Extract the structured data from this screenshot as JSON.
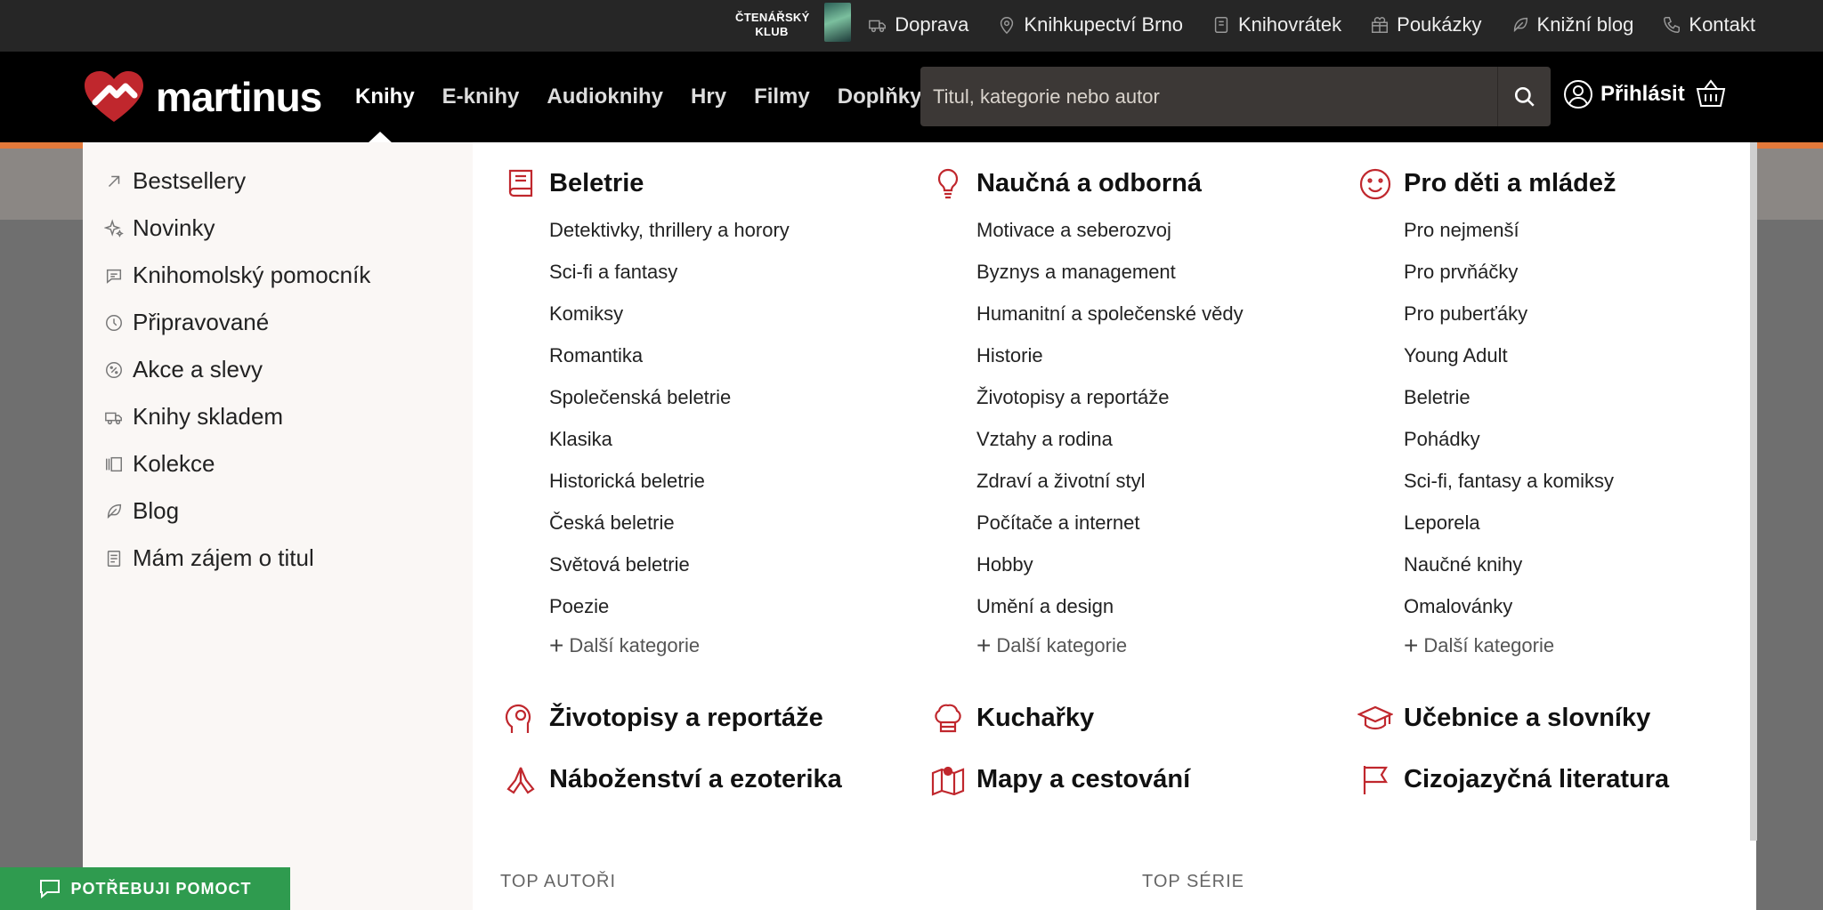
{
  "topbar": {
    "club_line1": "ČTENÁŘSKÝ",
    "club_line2": "KLUB",
    "links": [
      {
        "label": "Doprava",
        "icon": "truck-icon"
      },
      {
        "label": "Knihkupectví Brno",
        "icon": "map-pin-icon"
      },
      {
        "label": "Knihovrátek",
        "icon": "book-return-icon"
      },
      {
        "label": "Poukázky",
        "icon": "gift-icon"
      },
      {
        "label": "Knižní blog",
        "icon": "feather-icon"
      },
      {
        "label": "Kontakt",
        "icon": "phone-icon"
      }
    ]
  },
  "header": {
    "logo_text": "martinus",
    "nav": [
      {
        "label": "Knihy",
        "active": true
      },
      {
        "label": "E-knihy"
      },
      {
        "label": "Audioknihy"
      },
      {
        "label": "Hry"
      },
      {
        "label": "Filmy"
      },
      {
        "label": "Doplňky"
      }
    ],
    "search_placeholder": "Titul, kategorie nebo autor",
    "login_label": "Přihlásit"
  },
  "sidebar": {
    "items": [
      {
        "label": "Bestsellery",
        "icon": "arrow-up-right-icon"
      },
      {
        "label": "Novinky",
        "icon": "sparkle-icon"
      },
      {
        "label": "Knihomolský pomocník",
        "icon": "chat-icon"
      },
      {
        "label": "Připravované",
        "icon": "clock-icon"
      },
      {
        "label": "Akce a slevy",
        "icon": "discount-icon"
      },
      {
        "label": "Knihy skladem",
        "icon": "truck-icon"
      },
      {
        "label": "Kolekce",
        "icon": "collection-icon"
      },
      {
        "label": "Blog",
        "icon": "feather-icon"
      },
      {
        "label": "Mám zájem o titul",
        "icon": "document-icon"
      }
    ]
  },
  "columns": [
    {
      "title": "Beletrie",
      "icon": "book-icon",
      "items": [
        "Detektivky, thrillery a horory",
        "Sci-fi a fantasy",
        "Komiksy",
        "Romantika",
        "Společenská beletrie",
        "Klasika",
        "Historická beletrie",
        "Česká beletrie",
        "Světová beletrie",
        "Poezie"
      ],
      "more": "Další kategorie"
    },
    {
      "title": "Naučná a odborná",
      "icon": "lightbulb-icon",
      "items": [
        "Motivace a seberozvoj",
        "Byznys a management",
        "Humanitní a společenské vědy",
        "Historie",
        "Životopisy a reportáže",
        "Vztahy a rodina",
        "Zdraví a životní styl",
        "Počítače a internet",
        "Hobby",
        "Umění a design"
      ],
      "more": "Další kategorie"
    },
    {
      "title": "Pro děti a mládež",
      "icon": "smiley-icon",
      "items": [
        "Pro nejmenší",
        "Pro prvňáčky",
        "Pro puberťáky",
        "Young Adult",
        "Beletrie",
        "Pohádky",
        "Sci-fi, fantasy a komiksy",
        "Leporela",
        "Naučné knihy",
        "Omalovánky"
      ],
      "more": "Další kategorie"
    }
  ],
  "extra_categories": [
    {
      "label": "Životopisy a reportáže",
      "icon": "head-icon"
    },
    {
      "label": "Kuchařky",
      "icon": "chef-hat-icon"
    },
    {
      "label": "Učebnice a slovníky",
      "icon": "graduation-cap-icon"
    },
    {
      "label": "Náboženství a ezoterika",
      "icon": "praying-hands-icon"
    },
    {
      "label": "Mapy a cestování",
      "icon": "map-icon"
    },
    {
      "label": "Cizojazyčná literatura",
      "icon": "flag-icon"
    }
  ],
  "sections": {
    "top_authors": "TOP AUTOŘI",
    "top_series": "TOP SÉRIE"
  },
  "help_button": "POTŘEBUJI POMOCT",
  "colors": {
    "brand_red": "#c0272d",
    "accent_orange": "#e2793b",
    "help_green": "#2f9b4f"
  }
}
